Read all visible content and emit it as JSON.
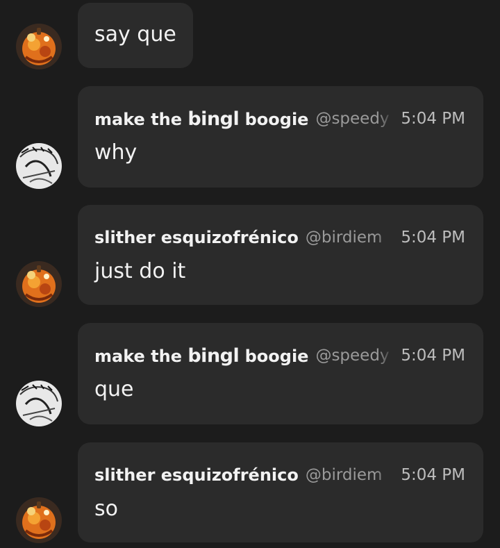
{
  "messages": [
    {
      "text": "say que",
      "avatar": "pumpkin-avatar-icon"
    },
    {
      "author_prefix": "make the",
      "author_bold": "bingl",
      "author_suffix": "boogie",
      "handle": "@speedy",
      "time": "5:04 PM",
      "text": "why",
      "avatar": "sketch-avatar-icon"
    },
    {
      "author": "slither esquizofrénico",
      "handle": "@birdiem",
      "time": "5:04 PM",
      "text": "just do it",
      "avatar": "pumpkin-avatar-icon"
    },
    {
      "author_prefix": "make the",
      "author_bold": "bingl",
      "author_suffix": "boogie",
      "handle": "@speedy",
      "time": "5:04 PM",
      "text": "que",
      "avatar": "sketch-avatar-icon"
    },
    {
      "author": "slither esquizofrénico",
      "handle": "@birdiem",
      "time": "5:04 PM",
      "text": "so",
      "avatar": "pumpkin-avatar-icon"
    }
  ],
  "colors": {
    "background": "#1c1c1c",
    "bubble": "#2b2b2b",
    "text": "#f2f2f2",
    "muted": "#9a9a9a"
  }
}
